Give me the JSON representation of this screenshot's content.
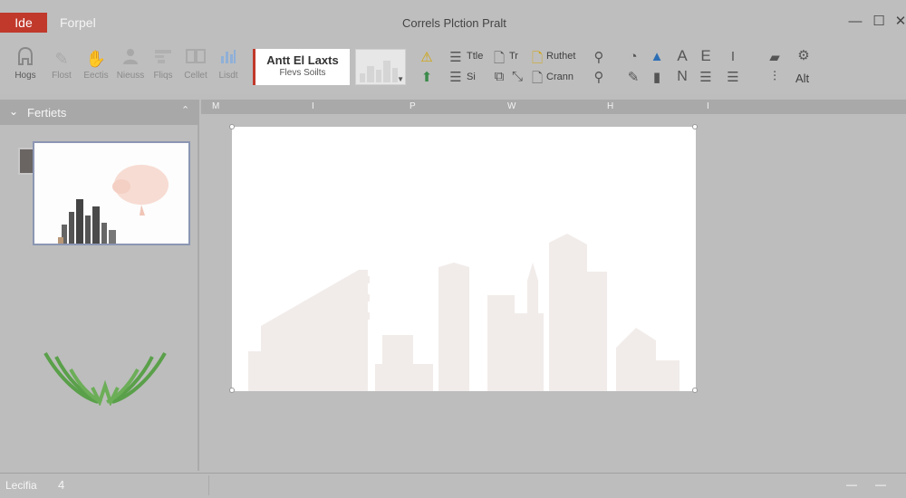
{
  "titlebar": {
    "file_tab": "Ide",
    "menu_tab": "Forpel",
    "doc_title": "Correls Plction Pralt",
    "minimize": "—",
    "maximize": "☐",
    "close": "✕"
  },
  "ribbon": {
    "big_buttons": [
      {
        "label": "Hogs",
        "icon": "home-icon"
      },
      {
        "label": "Flost",
        "icon": "pin-icon"
      },
      {
        "label": "Eectis",
        "icon": "hand-icon"
      },
      {
        "label": "Nieuss",
        "icon": "user-icon"
      },
      {
        "label": "Fliqs",
        "icon": "layout-icon"
      },
      {
        "label": "Cellet",
        "icon": "book-icon"
      },
      {
        "label": "Lisdt",
        "icon": "bar-chart-icon"
      }
    ],
    "font_box": {
      "name": "Antt El Laxts",
      "sub": "Flevs Soilts"
    },
    "small_labels": {
      "tile": "Ttle",
      "ti": "Tr",
      "ruthet": "Ruthet",
      "bullets": "Si",
      "crann": "Crann"
    },
    "right_labels": {
      "alt": "Alt"
    }
  },
  "sidebar": {
    "title": "Fertiets",
    "chevron": "⌄",
    "collapse": "⌃"
  },
  "ruler": {
    "marks": [
      "M",
      "I",
      "P",
      "W",
      "H",
      "I"
    ]
  },
  "statusbar": {
    "label": "Lecifia",
    "count": "4",
    "zoom_minus": "—",
    "zoom_plus": "—"
  }
}
